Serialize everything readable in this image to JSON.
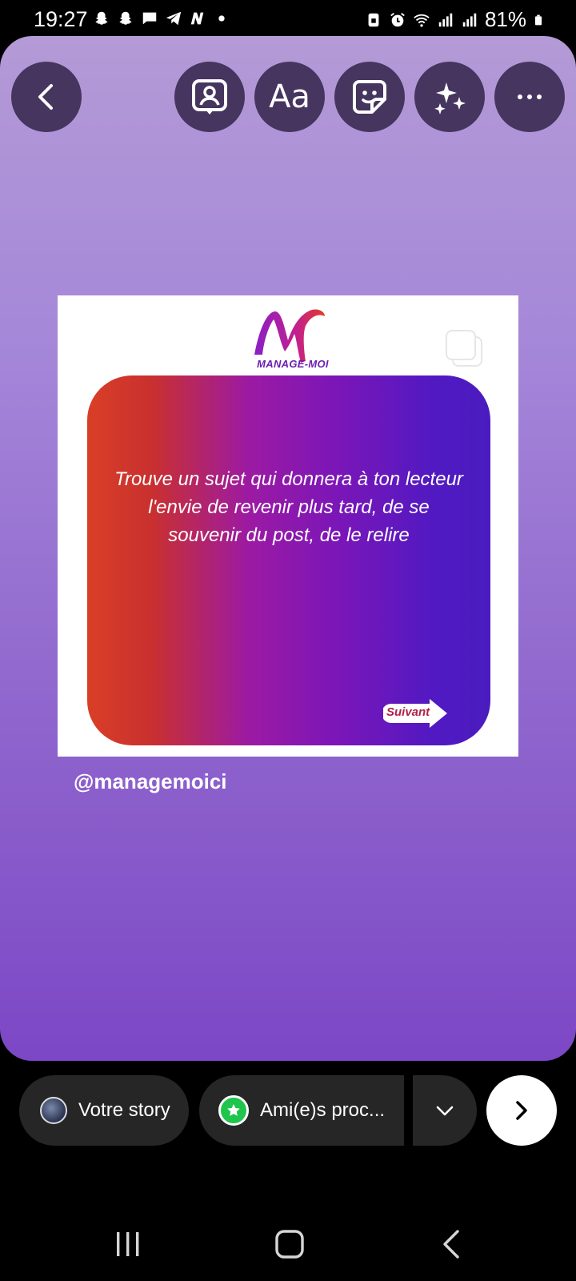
{
  "status_bar": {
    "time": "19:27",
    "battery": "81%",
    "left_icons": [
      "snapchat-icon",
      "snapchat-icon",
      "message-icon",
      "telegram-icon",
      "n-app-icon",
      "dot-icon"
    ],
    "right_icons": [
      "lock-battery-icon",
      "alarm-icon",
      "wifi-icon",
      "signal-icon",
      "signal-icon",
      "battery-icon"
    ]
  },
  "toolbar": {
    "back_icon": "chevron-left-icon",
    "mention_icon": "person-frame-icon",
    "text_label": "Aa",
    "sticker_icon": "sticker-icon",
    "effects_icon": "sparkles-icon",
    "more_icon": "more-icon"
  },
  "post": {
    "logo_text": "MANAGE-MOI",
    "quote": "Trouve un sujet qui donnera à ton lecteur l'envie de revenir plus tard, de se souvenir du post, de le relire",
    "next_label": "Suivant",
    "multi_icon": "carousel-icon"
  },
  "mention": "@managemoici",
  "share_bar": {
    "your_story": "Votre story",
    "close_friends": "Ami(e)s proc...",
    "dropdown_icon": "chevron-down-icon",
    "send_icon": "chevron-right-icon"
  },
  "nav": {
    "recents_icon": "recents-icon",
    "home_icon": "home-icon",
    "back_icon": "back-icon"
  },
  "colors": {
    "canvas_top": "#b49ad6",
    "canvas_bottom": "#7c47c6",
    "card_left": "#d93f26",
    "card_right": "#4a1cbf",
    "close_friends_green": "#1fc54c"
  }
}
